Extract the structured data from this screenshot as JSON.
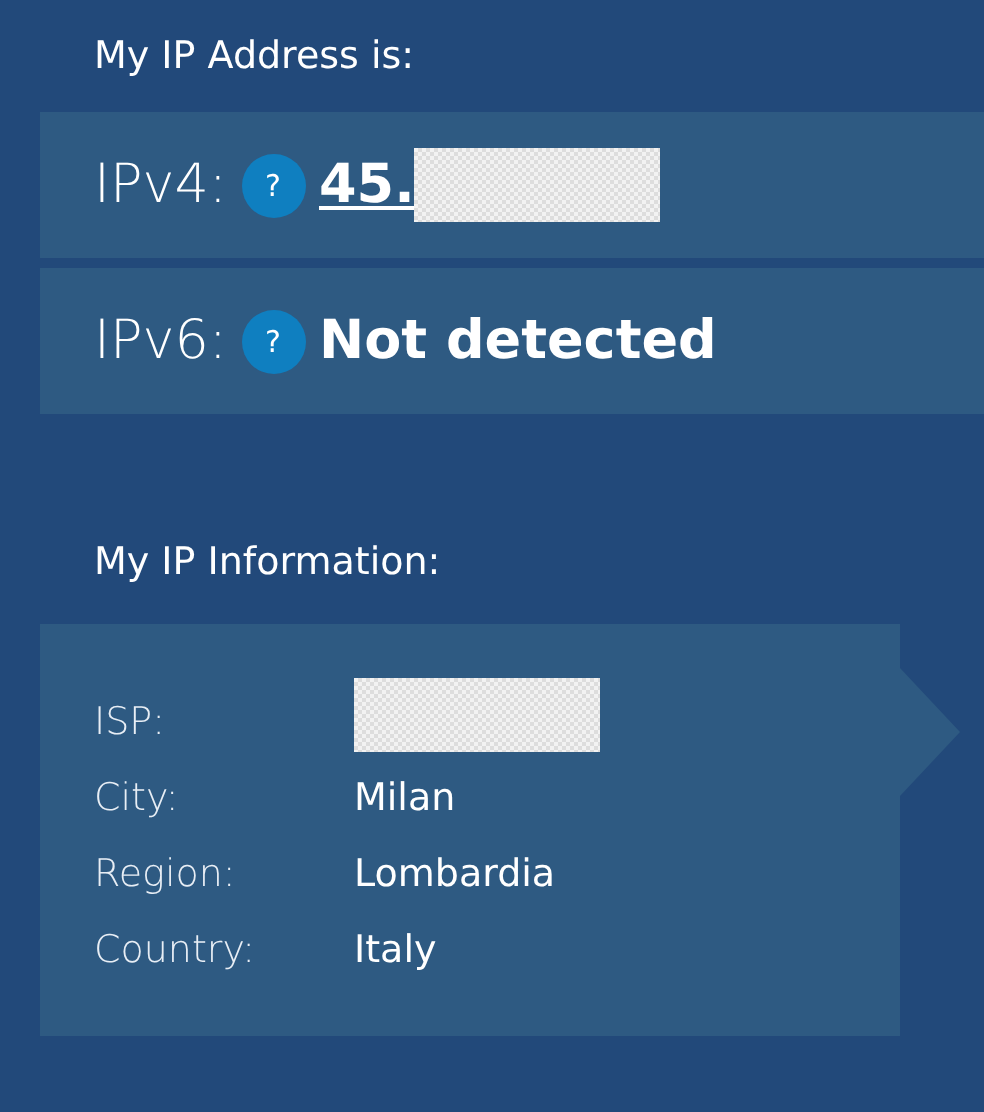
{
  "address_heading": "My IP Address is:",
  "addresses": [
    {
      "label": "IPv4:",
      "help_icon": "?",
      "value": "45.",
      "underlined": true,
      "redacted": true
    },
    {
      "label": "IPv6:",
      "help_icon": "?",
      "value": "Not detected",
      "underlined": false,
      "redacted": false
    }
  ],
  "info_heading": "My IP Information:",
  "info": [
    {
      "label": "ISP:",
      "redacted": true
    },
    {
      "label": "City:",
      "value": "Milan",
      "redacted": false
    },
    {
      "label": "Region:",
      "value": "Lombardia",
      "redacted": false
    },
    {
      "label": "Country:",
      "value": "Italy",
      "redacted": false
    }
  ]
}
